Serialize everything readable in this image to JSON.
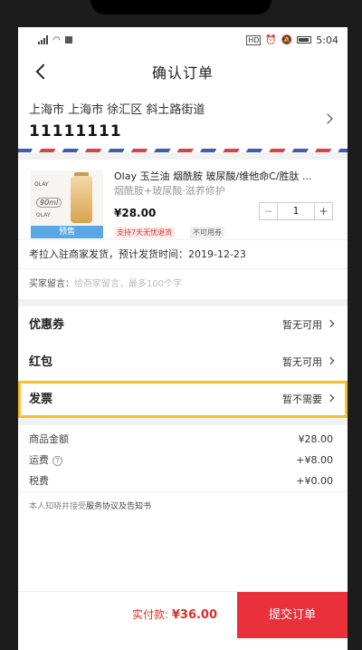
{
  "status_bar": {
    "time": "5:04",
    "hd": "HD"
  },
  "nav": {
    "title": "确认订单"
  },
  "address": {
    "region": "上海市 上海市 徐汇区 斜土路街道",
    "phone": "11111111"
  },
  "product": {
    "name": "Olay 玉兰油 烟酰胺 玻尿酸/维他命C/胜肽 ...",
    "spec": "烟酰胺+玻尿酸·滋养修护",
    "price": "¥28.00",
    "quantity": "1",
    "badge_return": "支持7天无忧退货",
    "badge_coupon": "不可用券",
    "thumb_tag": "预售",
    "thumb_text_volume": "90ml",
    "thumb_text_brand": "OLAY"
  },
  "shipping": {
    "text": "考拉入驻商家发货，预计发货时间：2019-12-23"
  },
  "message": {
    "label": "买家留言：",
    "placeholder": "给商家留言，最多100个字"
  },
  "options": [
    {
      "label": "优惠券",
      "value": "暂无可用"
    },
    {
      "label": "红包",
      "value": "暂无可用"
    },
    {
      "label": "发票",
      "value": "暂不需要"
    }
  ],
  "summary": [
    {
      "label": "商品金额",
      "value": "¥28.00"
    },
    {
      "label": "运费",
      "value": "+¥8.00"
    },
    {
      "label": "税费",
      "value": "+¥0.00"
    }
  ],
  "agreement": {
    "prefix": "本人知晓并接受",
    "link": "服务协议及告知书"
  },
  "footer": {
    "pay_label": "实付款: ",
    "pay_amount": "¥36.00",
    "submit_label": "提交订单"
  },
  "colors": {
    "accent": "#e9303b",
    "highlight": "#f5c12a",
    "presale_tag": "#5aa7e6"
  }
}
